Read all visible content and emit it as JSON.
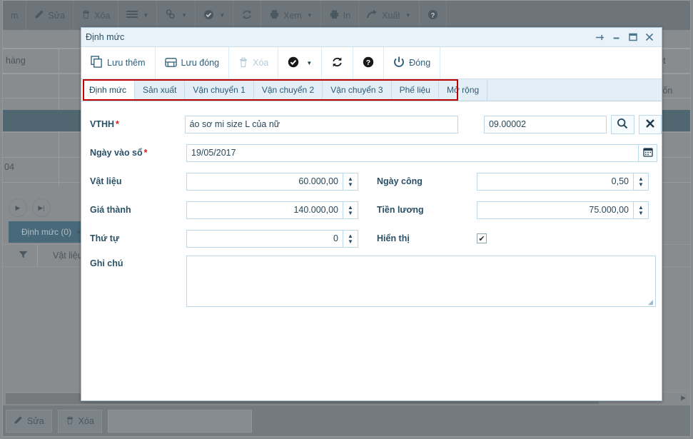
{
  "background": {
    "toolbar_buttons": [
      {
        "label": "m",
        "icon": "partial-icon",
        "caret": false
      },
      {
        "label": "Sửa",
        "icon": "pencil-icon",
        "caret": false
      },
      {
        "label": "Xóa",
        "icon": "trash-icon",
        "caret": false
      },
      {
        "label": "",
        "icon": "list-icon",
        "caret": true
      },
      {
        "label": "",
        "icon": "link-icon",
        "caret": true
      },
      {
        "label": "",
        "icon": "check-circle-icon",
        "caret": true
      },
      {
        "label": "",
        "icon": "refresh-icon",
        "caret": false
      },
      {
        "label": "Xem",
        "icon": "printer-icon",
        "caret": true
      },
      {
        "label": "In",
        "icon": "printer-icon",
        "caret": false
      },
      {
        "label": "Xuất",
        "icon": "export-arrow-icon",
        "caret": true
      },
      {
        "label": "",
        "icon": "help-icon",
        "caret": false
      }
    ],
    "grid": {
      "col_header_left": "hàng",
      "col_header_right_1": "duyệt",
      "col_header_right_2": "giá vốn",
      "cell_value": "04"
    },
    "pager": {
      "next_label": "▶",
      "last_label": "▶|"
    },
    "subtab_label": "Định mức (0)",
    "subgrid_headers": [
      "Vật liệu"
    ],
    "bottom_buttons": [
      {
        "label": "Sửa",
        "icon": "pencil-icon"
      },
      {
        "label": "Xóa",
        "icon": "trash-icon"
      }
    ]
  },
  "modal": {
    "title": "Định mức",
    "window_controls": [
      {
        "name": "pin-icon",
        "glyph": "⊣"
      },
      {
        "name": "minimize-icon",
        "glyph": "—"
      },
      {
        "name": "maximize-icon",
        "glyph": "❐"
      },
      {
        "name": "close-icon",
        "glyph": "✕"
      }
    ],
    "toolbar": [
      {
        "label": "Lưu thêm",
        "icon": "copy-save-icon",
        "caret": false,
        "disabled": false
      },
      {
        "label": "Lưu đóng",
        "icon": "save-close-icon",
        "caret": false,
        "disabled": false
      },
      {
        "label": "Xóa",
        "icon": "trash-icon",
        "caret": false,
        "disabled": true
      },
      {
        "label": "",
        "icon": "check-circle-icon",
        "caret": true,
        "disabled": false
      },
      {
        "label": "",
        "icon": "refresh-icon",
        "caret": false,
        "disabled": false
      },
      {
        "label": "",
        "icon": "help-icon",
        "caret": false,
        "disabled": false
      },
      {
        "label": "Đóng",
        "icon": "power-icon",
        "caret": false,
        "disabled": false
      }
    ],
    "tabs": [
      {
        "label": "Định mức",
        "active": true
      },
      {
        "label": "Sản xuất",
        "active": false
      },
      {
        "label": "Vận chuyển 1",
        "active": false
      },
      {
        "label": "Vận chuyển 2",
        "active": false
      },
      {
        "label": "Vận chuyển 3",
        "active": false
      },
      {
        "label": "Phế liệu",
        "active": false
      },
      {
        "label": "Mở rộng",
        "active": false
      }
    ],
    "highlight_color": "#c00000",
    "form": {
      "vthh": {
        "label": "VTHH",
        "required": true,
        "value": "áo sơ mi size L  của nữ",
        "code_value": "09.00002",
        "search_icon": "magnifier-icon",
        "clear_icon": "close-x-icon"
      },
      "ngay_vao_so": {
        "label": "Ngày vào sổ",
        "required": true,
        "value": "19/05/2017",
        "picker_icon": "calendar-icon"
      },
      "vat_lieu": {
        "label": "Vật liệu",
        "value": "60.000,00"
      },
      "ngay_cong": {
        "label": "Ngày công",
        "value": "0,50"
      },
      "gia_thanh": {
        "label": "Giá thành",
        "value": "140.000,00"
      },
      "tien_luong": {
        "label": "Tiền lương",
        "value": "75.000,00"
      },
      "thu_tu": {
        "label": "Thứ tự",
        "value": "0"
      },
      "hien_thi": {
        "label": "Hiển thị",
        "checked": true,
        "glyph": "✔"
      },
      "ghi_chu": {
        "label": "Ghi chú",
        "value": "",
        "placeholder": ""
      }
    }
  }
}
